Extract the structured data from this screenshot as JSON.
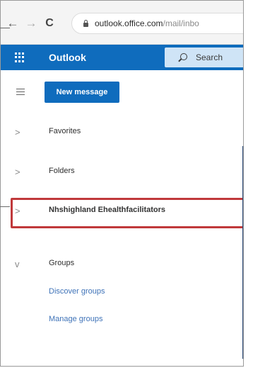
{
  "browser": {
    "back_icon": "←",
    "forward_icon": "→",
    "reload_icon": "C",
    "url_host": "outlook.office.com",
    "url_path": "/mail/inbo"
  },
  "header": {
    "title": "Outlook",
    "search_placeholder": "Search",
    "brand_color": "#0f6cbd"
  },
  "sidebar": {
    "new_message_label": "New message",
    "items": [
      {
        "label": "Favorites",
        "chevron": ">"
      },
      {
        "label": "Folders",
        "chevron": ">"
      },
      {
        "label": "Nhshighland Ehealthfacilitators",
        "chevron": ">"
      },
      {
        "label": "Groups",
        "chevron": "v"
      }
    ],
    "group_links": [
      {
        "label": "Discover groups"
      },
      {
        "label": "Manage groups"
      }
    ]
  },
  "highlight_color": "#c0393b",
  "icons": {
    "app_launcher": "waffle-icon",
    "menu": "hamburger-icon",
    "search": "search-icon",
    "secure": "lock-icon"
  }
}
